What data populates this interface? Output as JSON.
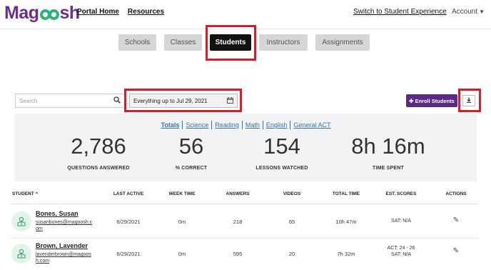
{
  "header": {
    "logo": {
      "prefix": "Mag",
      "suffix": "sh"
    },
    "nav": [
      "Portal Home",
      "Resources"
    ],
    "switch_link": "Switch to Student Experience",
    "account": "Account"
  },
  "tabs": [
    {
      "label": "Schools",
      "active": false
    },
    {
      "label": "Classes",
      "active": false
    },
    {
      "label": "Students",
      "active": true
    },
    {
      "label": "Instructors",
      "active": false
    },
    {
      "label": "Assignments",
      "active": false
    }
  ],
  "controls": {
    "search_placeholder": "Search",
    "date_filter": "Everything up to Jul 29, 2021",
    "enroll_button": "Enroll Students"
  },
  "filters": [
    "Totals",
    "Science",
    "Reading",
    "Math",
    "English",
    "General ACT"
  ],
  "active_filter": "Totals",
  "stats": [
    {
      "value": "2,786",
      "label": "QUESTIONS ANSWERED"
    },
    {
      "value": "56",
      "label": "% CORRECT"
    },
    {
      "value": "154",
      "label": "LESSONS WATCHED"
    },
    {
      "value": "8h 16m",
      "label": "TIME SPENT"
    }
  ],
  "table": {
    "columns": [
      "STUDENT",
      "LAST ACTIVE",
      "WEEK TIME",
      "ANSWERS",
      "VIDEOS",
      "TOTAL TIME",
      "EST. SCORES",
      "ACTIONS"
    ],
    "sort_indicator": "^",
    "rows": [
      {
        "name": "Bones, Susan",
        "email": "susanbones@magoosh.com",
        "last_active": "6/29/2021",
        "week_time": "0m",
        "answers": "218",
        "videos": "65",
        "total_time": "10h 47m",
        "est_scores": [
          "SAT: N/A"
        ]
      },
      {
        "name": "Brown, Lavender",
        "email": "lavenderbrown@magoosh.com",
        "last_active": "6/29/2021",
        "week_time": "0m",
        "answers": "595",
        "videos": "20",
        "total_time": "7h 32m",
        "est_scores": [
          "ACT: 24 - 26",
          "SAT: N/A"
        ]
      }
    ]
  },
  "colors": {
    "brand_purple": "#6a2e8e",
    "brand_green": "#27b37a",
    "enroll_button": "#5b2a85",
    "highlight_red": "#d0202e",
    "link_blue": "#3a6fb0"
  }
}
